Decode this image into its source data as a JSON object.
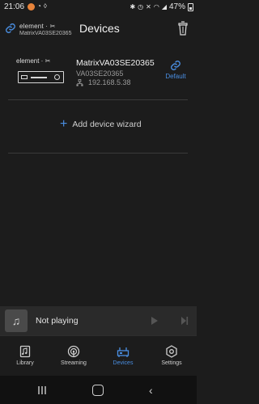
{
  "status": {
    "time": "21:06",
    "battery": "47%"
  },
  "appbar": {
    "brand": "element · ✂",
    "device_id": "MatrixVA03SE20365",
    "title": "Devices"
  },
  "device": {
    "brand": "element · ✂",
    "name": "MatrixVA03SE20365",
    "model": "VA03SE20365",
    "ip": "192.168.5.38",
    "default_label": "Default"
  },
  "wizard": {
    "label": "Add device wizard"
  },
  "player": {
    "status": "Not playing"
  },
  "tabs": [
    {
      "label": "Library",
      "icon": "library-icon"
    },
    {
      "label": "Streaming",
      "icon": "streaming-icon"
    },
    {
      "label": "Devices",
      "icon": "devices-icon"
    },
    {
      "label": "Settings",
      "icon": "settings-icon"
    }
  ],
  "colors": {
    "accent": "#4a8fe3",
    "background": "#1c1c1c",
    "player_bar": "#2a2a2a"
  }
}
